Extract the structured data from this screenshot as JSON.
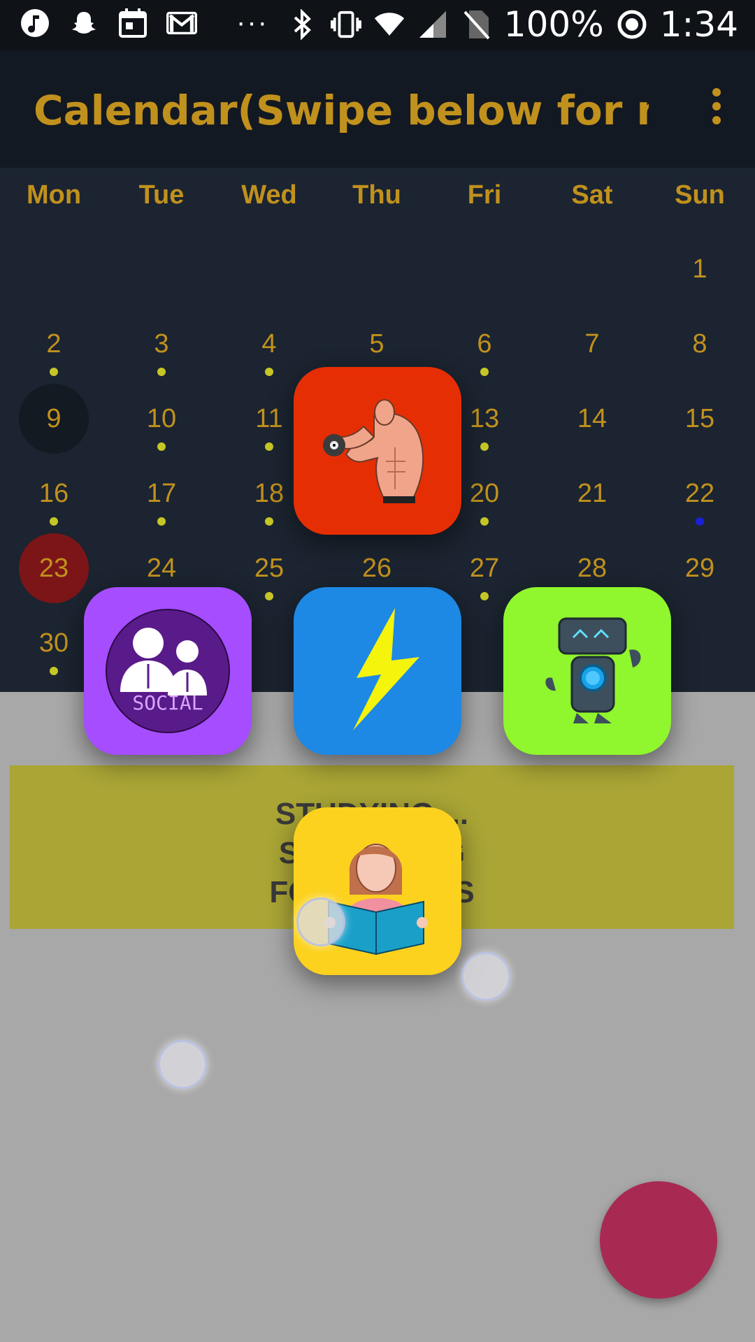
{
  "status_bar": {
    "battery": "100%",
    "time": "1:34",
    "more": "···",
    "icons": [
      "music-icon",
      "snapchat-icon",
      "calendar-icon",
      "gmail-icon",
      "bluetooth-icon",
      "vibrate-icon",
      "wifi-icon",
      "signal-icon",
      "no-sim-icon",
      "focus-icon"
    ]
  },
  "app_bar": {
    "title": "Calendar(Swipe below for m…"
  },
  "calendar": {
    "weekdays": [
      "Mon",
      "Tue",
      "Wed",
      "Thu",
      "Fri",
      "Sat",
      "Sun"
    ],
    "days": {
      "d1": "1",
      "d2": "2",
      "d3": "3",
      "d4": "4",
      "d5": "5",
      "d6": "6",
      "d7": "7",
      "d8": "8",
      "d9": "9",
      "d10": "10",
      "d11": "11",
      "d13": "13",
      "d14": "14",
      "d15": "15",
      "d16": "16",
      "d17": "17",
      "d18": "18",
      "d20": "20",
      "d21": "21",
      "d22": "22",
      "d23": "23",
      "d24": "24",
      "d25": "25",
      "d26": "26",
      "d27": "27",
      "d28": "28",
      "d29": "29",
      "d30": "30"
    },
    "today": "9",
    "selected": "23",
    "dot_color": "#c6c626",
    "event_dot_color": "#1a20d6",
    "selected_color": "#7c1517"
  },
  "banner": {
    "line1": "STUDYING ...",
    "line2": "SU              G",
    "line3": "FO              RS"
  },
  "launcher": {
    "tiles": [
      {
        "name": "fitness",
        "color": "#e62e04"
      },
      {
        "name": "social",
        "color": "#a64dff",
        "logo_text": "SOCIAL"
      },
      {
        "name": "energy",
        "color": "#1e88e5"
      },
      {
        "name": "robot",
        "color": "#90f62d"
      },
      {
        "name": "study",
        "color": "#fcd21f"
      }
    ]
  },
  "fab": {
    "color": "#a82a52"
  }
}
